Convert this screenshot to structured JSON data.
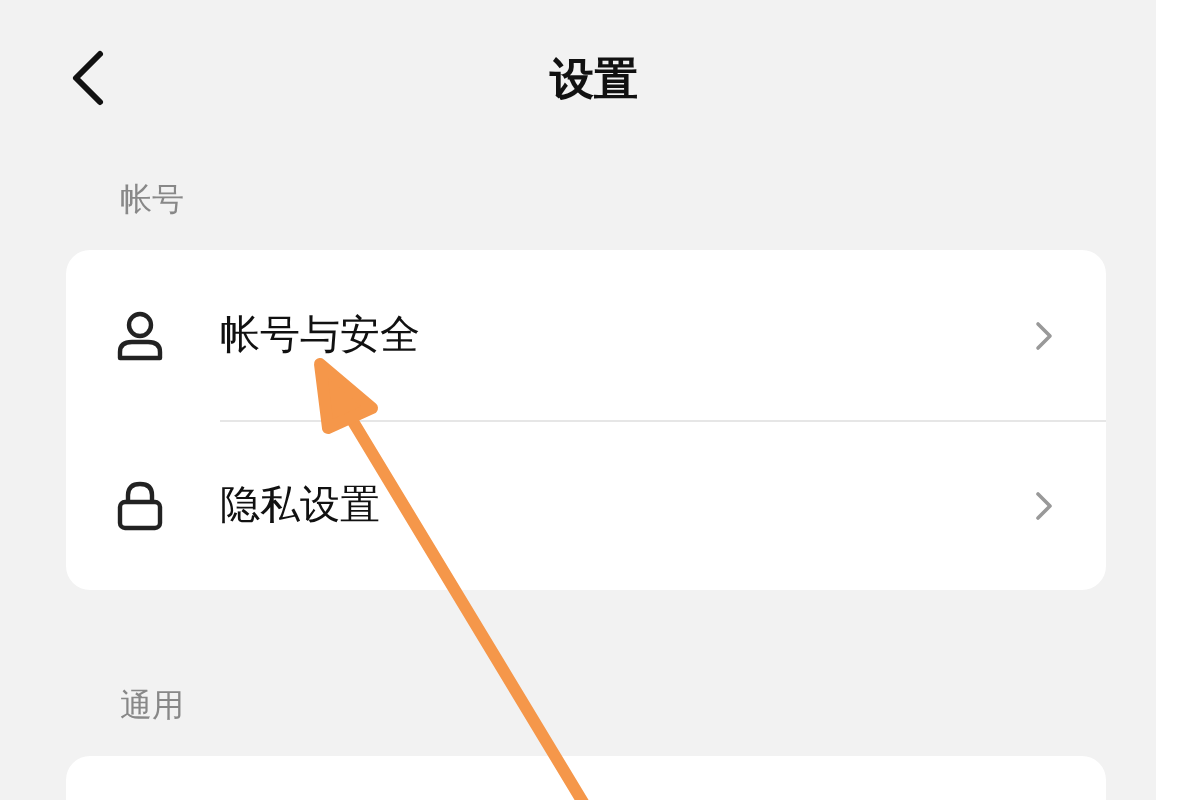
{
  "header": {
    "title": "设置"
  },
  "sections": [
    {
      "title": "帐号",
      "items": [
        {
          "label": "帐号与安全",
          "kind": "person"
        },
        {
          "label": "隐私设置",
          "kind": "lock"
        }
      ]
    },
    {
      "title": "通用"
    }
  ]
}
